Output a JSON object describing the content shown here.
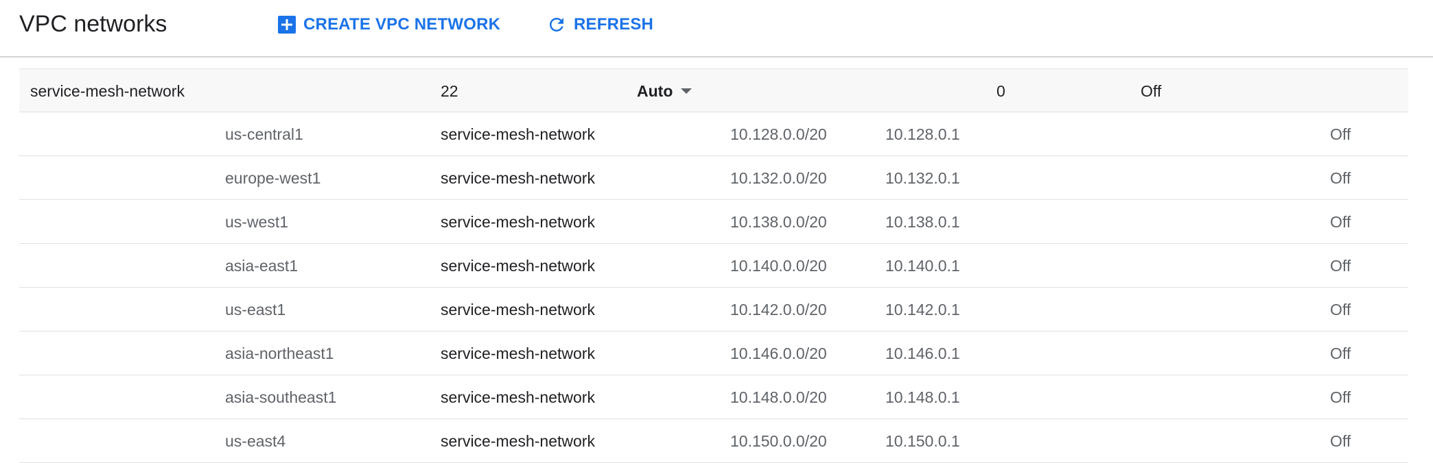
{
  "header": {
    "title": "VPC networks",
    "create_label": "CREATE VPC NETWORK",
    "refresh_label": "REFRESH",
    "create_icon": "add-box-icon",
    "refresh_icon": "refresh-icon"
  },
  "network": {
    "name": "service-mesh-network",
    "subnet_count": "22",
    "mode": "Auto",
    "mode_icon": "caret-down-icon",
    "rules_count": "0",
    "setting": "Off"
  },
  "subnets": [
    {
      "region": "us-central1",
      "network": "service-mesh-network",
      "range": "10.128.0.0/20",
      "gateway": "10.128.0.1",
      "setting": "Off"
    },
    {
      "region": "europe-west1",
      "network": "service-mesh-network",
      "range": "10.132.0.0/20",
      "gateway": "10.132.0.1",
      "setting": "Off"
    },
    {
      "region": "us-west1",
      "network": "service-mesh-network",
      "range": "10.138.0.0/20",
      "gateway": "10.138.0.1",
      "setting": "Off"
    },
    {
      "region": "asia-east1",
      "network": "service-mesh-network",
      "range": "10.140.0.0/20",
      "gateway": "10.140.0.1",
      "setting": "Off"
    },
    {
      "region": "us-east1",
      "network": "service-mesh-network",
      "range": "10.142.0.0/20",
      "gateway": "10.142.0.1",
      "setting": "Off"
    },
    {
      "region": "asia-northeast1",
      "network": "service-mesh-network",
      "range": "10.146.0.0/20",
      "gateway": "10.146.0.1",
      "setting": "Off"
    },
    {
      "region": "asia-southeast1",
      "network": "service-mesh-network",
      "range": "10.148.0.0/20",
      "gateway": "10.148.0.1",
      "setting": "Off"
    },
    {
      "region": "us-east4",
      "network": "service-mesh-network",
      "range": "10.150.0.0/20",
      "gateway": "10.150.0.1",
      "setting": "Off"
    }
  ],
  "colors": {
    "accent": "#1a73e8",
    "text": "#202124",
    "muted": "#5f6368"
  }
}
